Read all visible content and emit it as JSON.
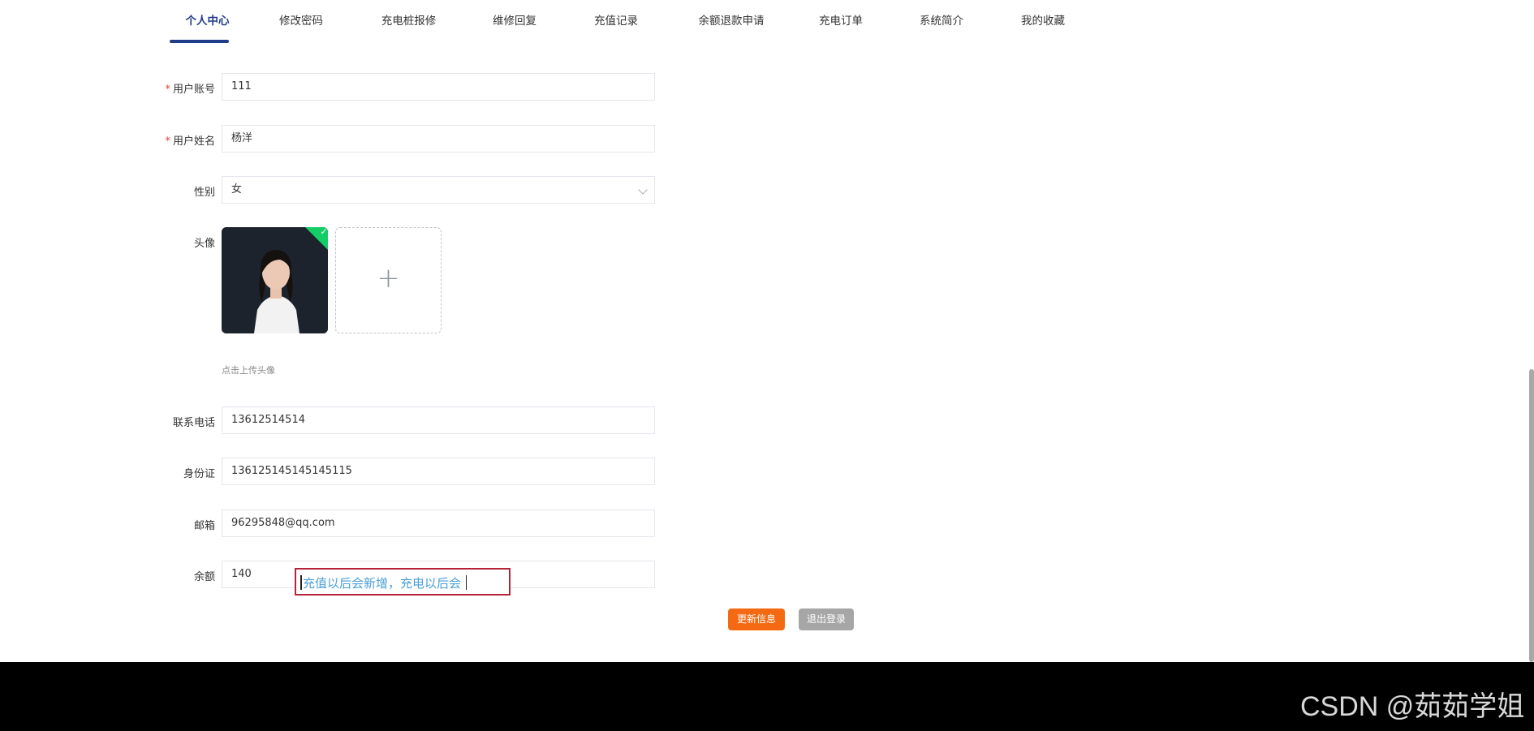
{
  "nav": {
    "tabs": [
      {
        "label": "个人中心",
        "active": true
      },
      {
        "label": "修改密码"
      },
      {
        "label": "充电桩报修"
      },
      {
        "label": "维修回复"
      },
      {
        "label": "充值记录"
      },
      {
        "label": "余额退款申请"
      },
      {
        "label": "充电订单"
      },
      {
        "label": "系统简介"
      },
      {
        "label": "我的收藏"
      }
    ]
  },
  "form": {
    "account": {
      "label": "用户账号",
      "required": "*",
      "value": "111"
    },
    "name": {
      "label": "用户姓名",
      "required": "*",
      "value": "杨洋"
    },
    "gender": {
      "label": "性别",
      "value": "女"
    },
    "avatar": {
      "label": "头像",
      "tip": "点击上传头像",
      "upload_icon": "plus-icon"
    },
    "phone": {
      "label": "联系电话",
      "value": "13612514514"
    },
    "id_card": {
      "label": "身份证",
      "value": "136125145145145115"
    },
    "email": {
      "label": "邮箱",
      "value": "96295848@qq.com"
    },
    "balance": {
      "label": "余额",
      "value": "140"
    }
  },
  "annotation": {
    "text": "充值以后会新增，充电以后会"
  },
  "buttons": {
    "update": "更新信息",
    "logout": "退出登录"
  },
  "watermark": "CSDN @茹茹学姐",
  "colors": {
    "active_tab": "#1f3c88",
    "update_button": "#f46a12",
    "logout_button": "#a6a6a6",
    "success": "#13ce66",
    "annotation_border": "#b5243a"
  }
}
